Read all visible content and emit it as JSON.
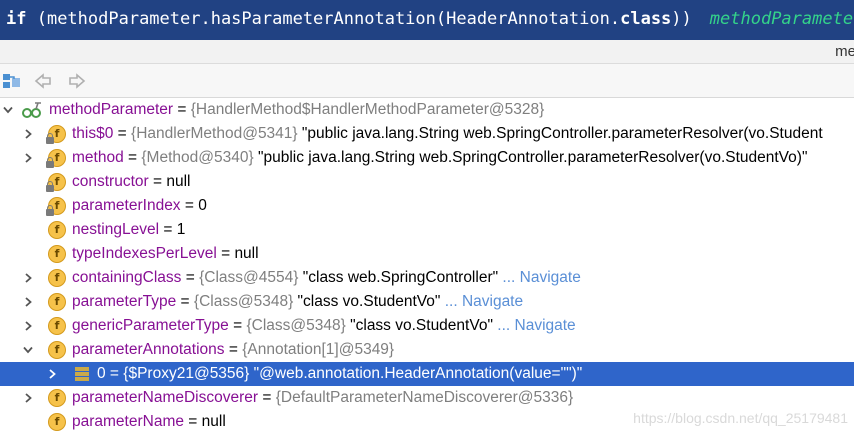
{
  "code_line": {
    "keyword": "if",
    "code": " (methodParameter.hasParameterAnnotation(HeaderAnnotation.",
    "class_kw": "class",
    "close": "))",
    "hint": "methodParameter:"
  },
  "panel_header": {
    "cut_label": "me"
  },
  "toolbar": {
    "buttons": [
      "restore-layout-icon",
      "back-arrow-icon",
      "forward-arrow-icon"
    ]
  },
  "tree": {
    "root": {
      "name": "methodParameter",
      "eq": " = ",
      "ref": "{HandlerMethod$HandlerMethodParameter@5328}"
    },
    "fields": [
      {
        "name": "this$0",
        "eq": " = ",
        "ref": "{HandlerMethod@5341}",
        "str": " \"public java.lang.String web.SpringController.parameterResolver(vo.Student",
        "nav": ""
      },
      {
        "name": "method",
        "eq": " = ",
        "ref": "{Method@5340}",
        "str": " \"public java.lang.String web.SpringController.parameterResolver(vo.StudentVo)\"",
        "nav": ""
      },
      {
        "name": "constructor",
        "eq": " = ",
        "val": "null"
      },
      {
        "name": "parameterIndex",
        "eq": " = ",
        "val": "0"
      },
      {
        "name": "nestingLevel",
        "eq": " = ",
        "val": "1"
      },
      {
        "name": "typeIndexesPerLevel",
        "eq": " = ",
        "val": "null"
      },
      {
        "name": "containingClass",
        "eq": " = ",
        "ref": "{Class@4554}",
        "str": " \"class web.SpringController\"",
        "nav": " ... Navigate"
      },
      {
        "name": "parameterType",
        "eq": " = ",
        "ref": "{Class@5348}",
        "str": " \"class vo.StudentVo\"",
        "nav": " ... Navigate"
      },
      {
        "name": "genericParameterType",
        "eq": " = ",
        "ref": "{Class@5348}",
        "str": " \"class vo.StudentVo\"",
        "nav": " ... Navigate"
      },
      {
        "name": "parameterAnnotations",
        "eq": " = ",
        "ref": "{Annotation[1]@5349}"
      },
      {
        "name": "0",
        "eq": " = ",
        "ref": "{$Proxy21@5356}",
        "str": " \"@web.annotation.HeaderAnnotation(value=\"\")\""
      },
      {
        "name": "parameterNameDiscoverer",
        "eq": " = ",
        "ref": "{DefaultParameterNameDiscoverer@5336}"
      },
      {
        "name": "parameterName",
        "eq": " = ",
        "val": "null"
      }
    ]
  },
  "watermark": "https://blog.csdn.net/qq_25179481",
  "colors": {
    "code_bar_bg": "#214283",
    "selection": "#2f65ca",
    "field_name": "#871094",
    "navigate_link": "#5a8fd6",
    "field_badge": "#f6c24a"
  }
}
